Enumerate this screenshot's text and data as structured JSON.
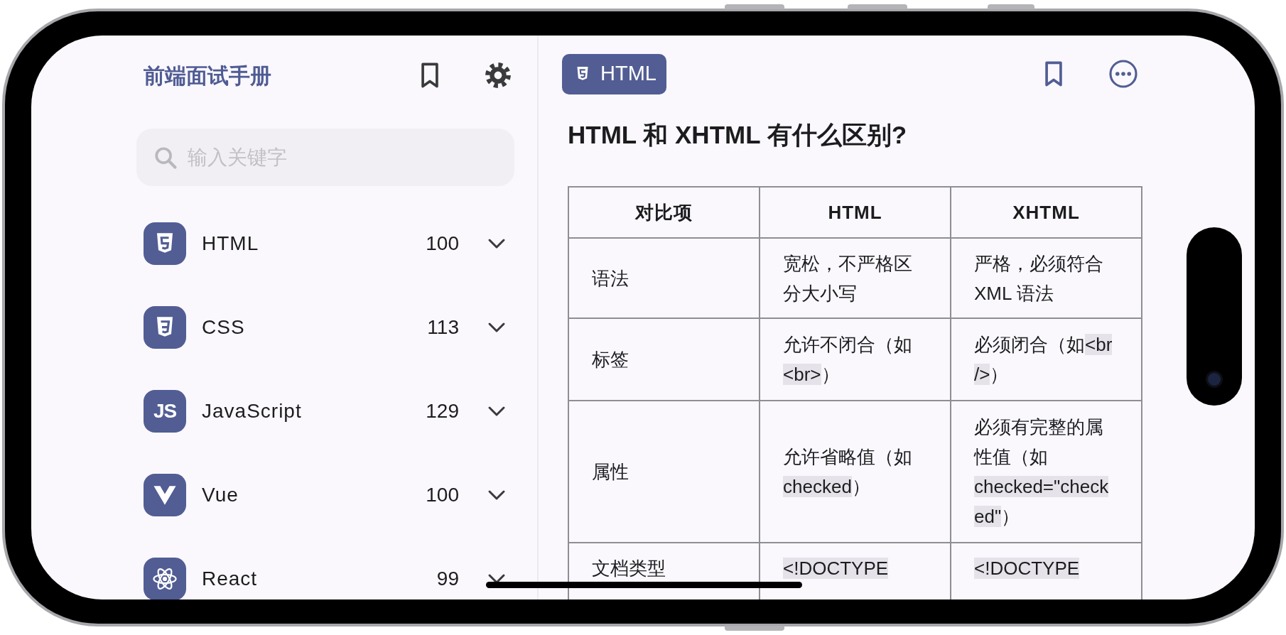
{
  "sidebar": {
    "title": "前端面试手册",
    "search": {
      "placeholder": "输入关键字"
    },
    "categories": [
      {
        "kind": "html5",
        "name": "HTML",
        "count": "100"
      },
      {
        "kind": "css3",
        "name": "CSS",
        "count": "113"
      },
      {
        "kind": "js",
        "icon_text": "JS",
        "name": "JavaScript",
        "count": "129"
      },
      {
        "kind": "vue",
        "name": "Vue",
        "count": "100"
      },
      {
        "kind": "react",
        "name": "React",
        "count": "99"
      }
    ]
  },
  "detail": {
    "badge": {
      "kind": "html5",
      "label": "HTML"
    },
    "question": "HTML 和 XHTML 有什么区别?",
    "table": {
      "columns": [
        "对比项",
        "HTML",
        "XHTML"
      ],
      "rows": [
        [
          [
            {
              "text": "语法"
            }
          ],
          [
            {
              "text": "宽松，不严格区分大小写"
            }
          ],
          [
            {
              "text": "严格，必须符合 XML 语法"
            }
          ]
        ],
        [
          [
            {
              "text": "标签"
            }
          ],
          [
            {
              "text": "允许不闭合（如"
            },
            {
              "text": "<br>",
              "code": true
            },
            {
              "text": "）"
            }
          ],
          [
            {
              "text": "必须闭合（如"
            },
            {
              "text": "<br />",
              "code": true
            },
            {
              "text": "）"
            }
          ]
        ],
        [
          [
            {
              "text": "属性"
            }
          ],
          [
            {
              "text": "允许省略值（如"
            },
            {
              "text": "checked",
              "code": true
            },
            {
              "text": "）"
            }
          ],
          [
            {
              "text": "必须有完整的属性值（如 "
            },
            {
              "text": "checked=\"checked\"",
              "code": true
            },
            {
              "text": "）"
            }
          ]
        ],
        [
          [
            {
              "text": "文档类型"
            }
          ],
          [
            {
              "text": "<!DOCTYPE",
              "code": true
            }
          ],
          [
            {
              "text": "<!DOCTYPE",
              "code": true
            }
          ]
        ]
      ]
    }
  }
}
